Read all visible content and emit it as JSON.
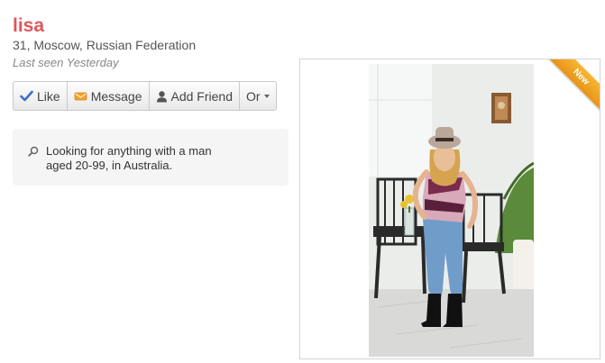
{
  "profile": {
    "name": "lisa",
    "details": "31, Moscow, Russian Federation",
    "last_seen": "Last seen Yesterday"
  },
  "actions": {
    "like": "Like",
    "message": "Message",
    "add_friend": "Add Friend",
    "more": "Or"
  },
  "looking_for": {
    "icon": "search-icon",
    "text": "Looking for anything with a man aged 20-99, in Australia."
  },
  "photo": {
    "badge": "New",
    "badge_color": "#f0a326"
  },
  "colors": {
    "name": "#e0565b",
    "like_icon": "#3b6fc9",
    "message_icon": "#f0a326"
  }
}
